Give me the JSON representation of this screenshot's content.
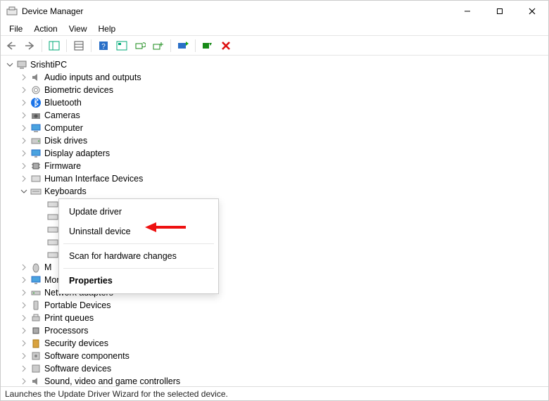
{
  "title": "Device Manager",
  "menus": {
    "file": "File",
    "action": "Action",
    "view": "View",
    "help": "Help"
  },
  "root": "SrishtiPC",
  "categories": [
    "Audio inputs and outputs",
    "Biometric devices",
    "Bluetooth",
    "Cameras",
    "Computer",
    "Disk drives",
    "Display adapters",
    "Firmware",
    "Human Interface Devices",
    "Keyboards",
    "Mice and other pointing devices",
    "Monitors",
    "Network adapters",
    "Portable Devices",
    "Print queues",
    "Processors",
    "Security devices",
    "Software components",
    "Software devices",
    "Sound, video and game controllers"
  ],
  "categories_truncated": {
    "mice": "M",
    "monitors": "Monitors"
  },
  "context_menu": {
    "update": "Update driver",
    "uninstall": "Uninstall device",
    "scan": "Scan for hardware changes",
    "properties": "Properties"
  },
  "status": "Launches the Update Driver Wizard for the selected device."
}
